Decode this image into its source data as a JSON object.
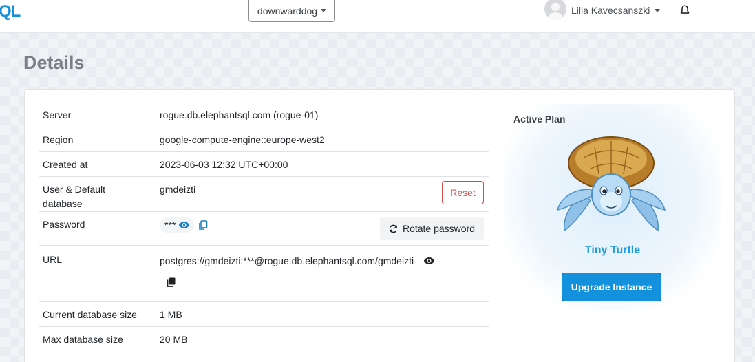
{
  "topbar": {
    "logo_text": "QL",
    "instance_selector": "downwarddog",
    "user_name": "Lilla Kavecsanszki"
  },
  "page": {
    "title": "Details"
  },
  "details": {
    "server_label": "Server",
    "server_value": "rogue.db.elephantsql.com (rogue-01)",
    "region_label": "Region",
    "region_value": "google-compute-engine::europe-west2",
    "created_label": "Created at",
    "created_value": "2023-06-03 12:32 UTC+00:00",
    "user_label": "User & Default database",
    "user_value": "gmdeizti",
    "reset_label": "Reset",
    "password_label": "Password",
    "password_masked": "***",
    "rotate_label": "Rotate password",
    "url_label": "URL",
    "url_value": "postgres://gmdeizti:***@rogue.db.elephantsql.com/gmdeizti",
    "current_size_label": "Current database size",
    "current_size_value": "1 MB",
    "max_size_label": "Max database size",
    "max_size_value": "20 MB"
  },
  "plan": {
    "label": "Active Plan",
    "name": "Tiny Turtle",
    "upgrade_label": "Upgrade Instance"
  },
  "colors": {
    "brand": "#1a91d6",
    "reset": "#d44b4b",
    "upgrade": "#1391dc",
    "plan_name": "#1f9bdd"
  },
  "icons": {
    "bell": "bell-icon",
    "eye": "eye-icon",
    "copy": "copy-icon",
    "rotate": "rotate-icon",
    "caret": "caret-down-icon"
  }
}
